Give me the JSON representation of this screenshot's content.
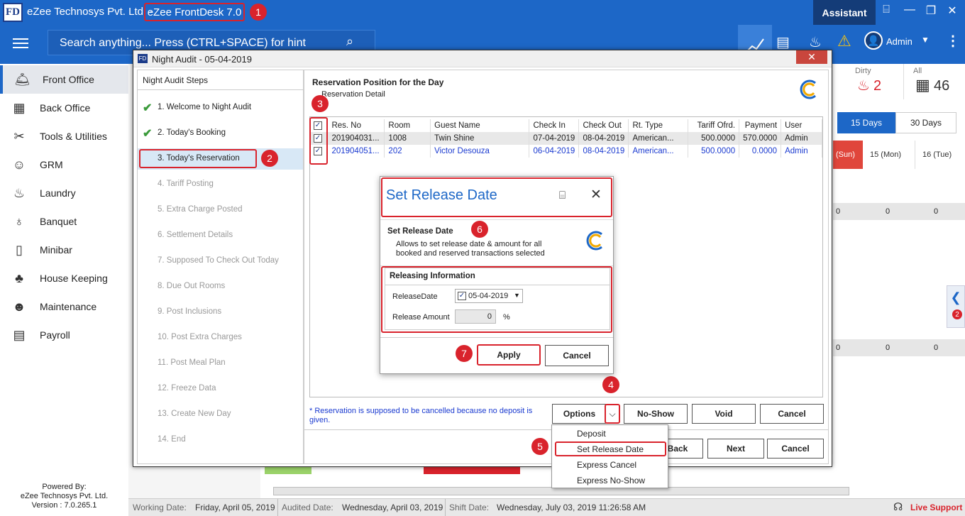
{
  "app": {
    "logo": "FD",
    "company": "eZee Technosys Pvt. Ltd. -",
    "product": "eZee FrontDesk 7.0",
    "assistant": "Assistant",
    "user": "Admin"
  },
  "search": {
    "placeholder": "Search anything... Press (CTRL+SPACE) for hint"
  },
  "sidebar": {
    "items": [
      {
        "label": "Front Office",
        "icon": "bell-icon",
        "glyph": "🛎"
      },
      {
        "label": "Back Office",
        "icon": "calculator-icon",
        "glyph": "▦"
      },
      {
        "label": "Tools & Utilities",
        "icon": "tools-icon",
        "glyph": "✂"
      },
      {
        "label": "GRM",
        "icon": "grm-icon",
        "glyph": "☺"
      },
      {
        "label": "Laundry",
        "icon": "iron-icon",
        "glyph": "♨"
      },
      {
        "label": "Banquet",
        "icon": "cutlery-icon",
        "glyph": "♁"
      },
      {
        "label": "Minibar",
        "icon": "fridge-icon",
        "glyph": "▯"
      },
      {
        "label": "House Keeping",
        "icon": "housekeeping-icon",
        "glyph": "♣"
      },
      {
        "label": "Maintenance",
        "icon": "maintenance-icon",
        "glyph": "☻"
      },
      {
        "label": "Payroll",
        "icon": "payroll-icon",
        "glyph": "▤"
      }
    ],
    "powered_by": "Powered By:",
    "powered_company": "eZee Technosys Pvt. Ltd.",
    "version": "Version : 7.0.265.1"
  },
  "right_panel": {
    "dirty_label": "Dirty",
    "dirty_count": "2",
    "all_label": "All",
    "all_count": "46",
    "tab_15": "15 Days",
    "tab_30": "30 Days",
    "col_sun": "(Sun)",
    "col_15": "15 (Mon)",
    "col_16": "16 (Tue)",
    "zero": "0",
    "badge": "2"
  },
  "footer": {
    "working_label": "Working Date:",
    "working_value": "Friday, April 05, 2019",
    "audited_label": "Audited Date:",
    "audited_value": "Wednesday, April 03, 2019",
    "shift_label": "Shift Date:",
    "shift_value": "Wednesday, July 03, 2019 11:26:58 AM",
    "live_support": "Live Support"
  },
  "dialog": {
    "title": "Night Audit - 05-04-2019",
    "steps_header": "Night Audit Steps",
    "steps": [
      "1.  Welcome to Night Audit",
      "2.  Today's Booking",
      "3.  Today's Reservation",
      "4.  Tariff Posting",
      "5.  Extra Charge Posted",
      "6.  Settlement Details",
      "7.  Supposed To Check Out Today",
      "8.  Due Out Rooms",
      "9. Post Inclusions",
      "10.  Post Extra Charges",
      "11.  Post Meal Plan",
      "12.  Freeze Data",
      "13.  Create New Day",
      "14.  End"
    ],
    "content_title": "Reservation Position for the Day",
    "content_subtitle": "Reservation Detail",
    "columns": [
      "Res. No",
      "Room",
      "Guest Name",
      "Check In",
      "Check Out",
      "Rt. Type",
      "Tariff Ofrd.",
      "Payment",
      "User"
    ],
    "rows": [
      [
        "201904031...",
        "1008",
        "Twin Shine",
        "07-04-2019",
        "08-04-2019",
        "American...",
        "500.0000",
        "570.0000",
        "Admin"
      ],
      [
        "201904051...",
        "202",
        "Victor Desouza",
        "06-04-2019",
        "08-04-2019",
        "American...",
        "500.0000",
        "0.0000",
        "Admin"
      ]
    ],
    "note": "* Reservation is supposed to be cancelled because no deposit is given.",
    "options": "Options",
    "noshow": "No-Show",
    "void": "Void",
    "cancel": "Cancel",
    "back": "Back",
    "next": "Next",
    "cancel2": "Cancel"
  },
  "popup": {
    "title": "Set Release Date",
    "section_title": "Set Release Date",
    "description": "Allows to set release date & amount for all booked and reserved transactions selected",
    "group_title": "Releasing Information",
    "release_date_label": "ReleaseDate",
    "release_date_value": "05-04-2019",
    "release_amount_label": "Release Amount",
    "release_amount_value": "0",
    "percent": "%",
    "apply": "Apply",
    "cancel": "Cancel"
  },
  "menu": {
    "items": [
      "Deposit",
      "Set Release Date",
      "Express Cancel",
      "Express No-Show"
    ]
  },
  "callouts": [
    "1",
    "2",
    "3",
    "4",
    "5",
    "6",
    "7"
  ],
  "colors": {
    "brand": "#1d67c7",
    "callout": "#d9232c",
    "link": "#1a3ad0"
  }
}
